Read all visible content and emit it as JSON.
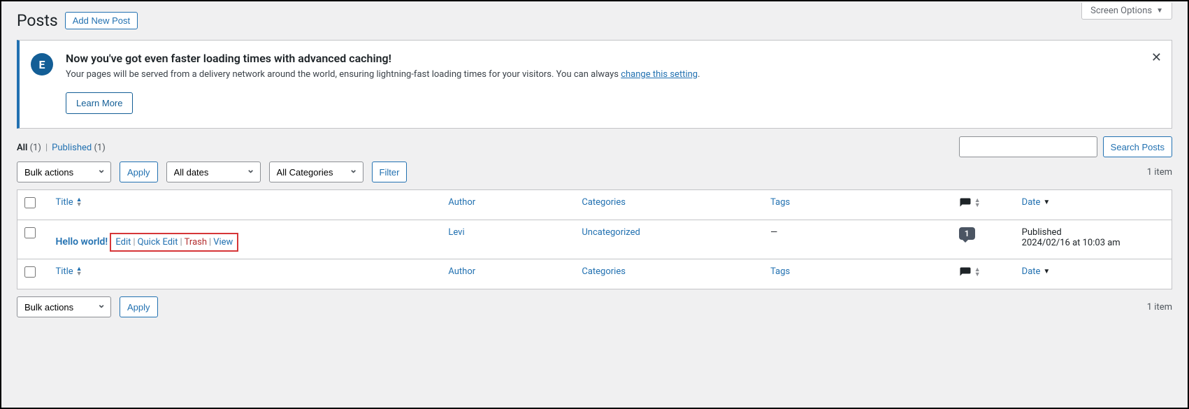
{
  "screen_options_label": "Screen Options",
  "page_title": "Posts",
  "add_new_label": "Add New Post",
  "notice": {
    "icon_text": "E",
    "headline": "Now you've got even faster loading times with advanced caching!",
    "body_prefix": "Your pages will be served from a delivery network around the world, ensuring lightning-fast loading times for your visitors. You can always ",
    "link_text": "change this setting",
    "body_suffix": ".",
    "learn_more": "Learn More"
  },
  "status_filters": {
    "all_label": "All",
    "all_count": "(1)",
    "published_label": "Published",
    "published_count": "(1)"
  },
  "search": {
    "button": "Search Posts"
  },
  "bulk": {
    "bulk_actions": "Bulk actions",
    "apply": "Apply",
    "all_dates": "All dates",
    "all_categories": "All Categories",
    "filter": "Filter"
  },
  "paging": "1 item",
  "columns": {
    "title": "Title",
    "author": "Author",
    "categories": "Categories",
    "tags": "Tags",
    "date": "Date"
  },
  "row": {
    "title": "Hello world!",
    "actions": {
      "edit": "Edit",
      "quick_edit": "Quick Edit",
      "trash": "Trash",
      "view": "View"
    },
    "author": "Levi",
    "category": "Uncategorized",
    "tags": "—",
    "comments": "1",
    "date_status": "Published",
    "date_value": "2024/02/16 at 10:03 am"
  }
}
